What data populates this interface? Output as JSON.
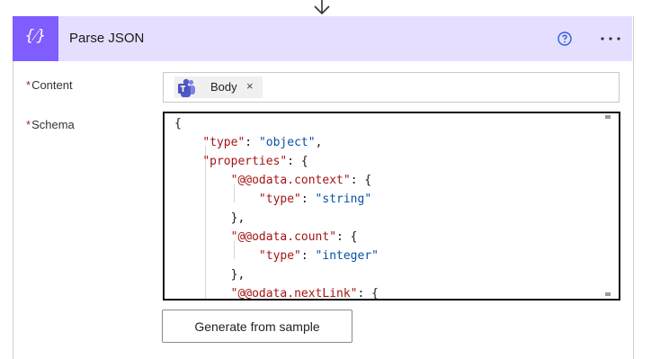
{
  "connector": {
    "arrow_icon": "arrow-down-icon"
  },
  "header": {
    "icon_glyph": "{⁄}",
    "title": "Parse JSON",
    "accent_color": "#7f5dff",
    "background_color": "#e5deff",
    "help_icon": "question-circle-icon",
    "more_icon": "ellipsis-icon"
  },
  "fields": {
    "content": {
      "required_mark": "*",
      "label": "Content",
      "token": {
        "icon": "teams-icon",
        "label": "Body",
        "close": "×"
      }
    },
    "schema": {
      "required_mark": "*",
      "label": "Schema",
      "code_lines": [
        "{",
        "    \"type\": \"object\",",
        "    \"properties\": {",
        "        \"@@odata.context\": {",
        "            \"type\": \"string\"",
        "        },",
        "        \"@@odata.count\": {",
        "            \"type\": \"integer\"",
        "        },",
        "        \"@@odata.nextLink\": {"
      ]
    }
  },
  "actions": {
    "generate_label": "Generate from sample"
  }
}
